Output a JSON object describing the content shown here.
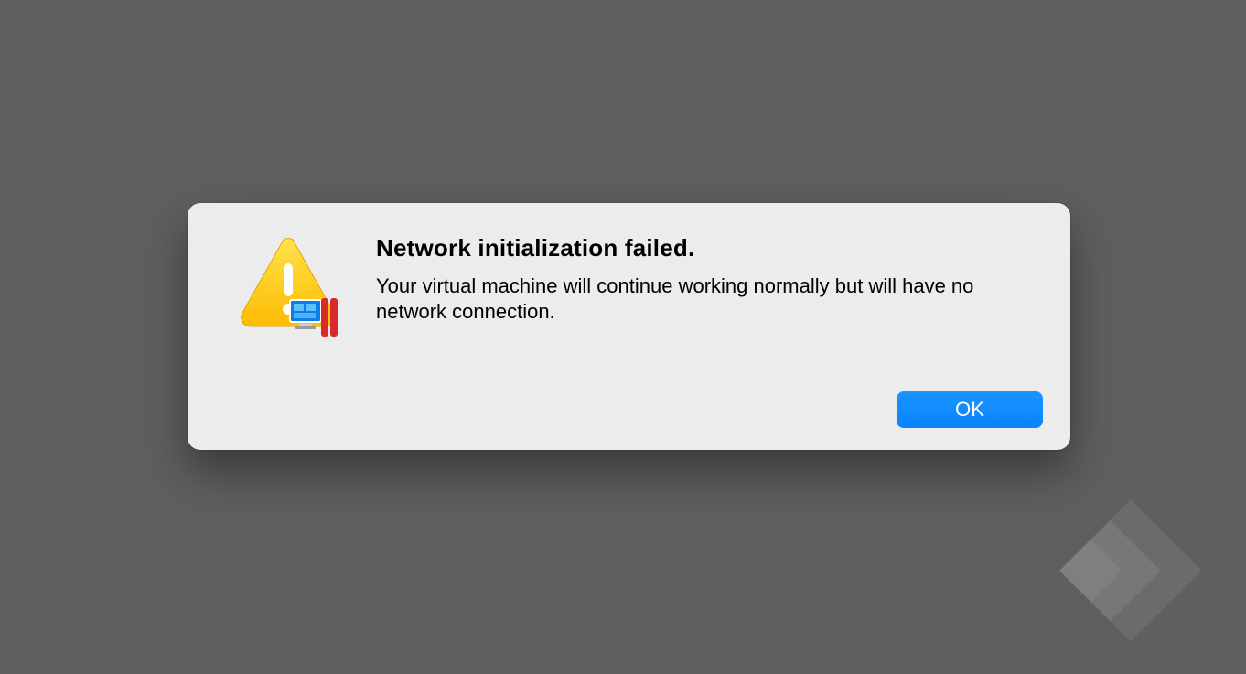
{
  "dialog": {
    "title": "Network initialization failed.",
    "message": "Your virtual machine will continue working normally but will have no network connection.",
    "ok_label": "OK"
  }
}
